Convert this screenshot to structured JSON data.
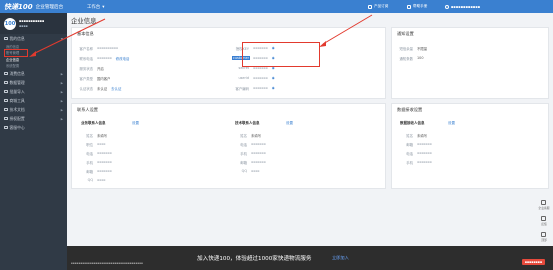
{
  "topbar": {
    "brand": "快递100",
    "subtitle": "企业管理后台",
    "console_label": "工作台",
    "caret": "▾",
    "right_links": [
      {
        "label": "产品订阅",
        "icon": "product-icon"
      },
      {
        "label": "帮助手册",
        "icon": "help-icon"
      }
    ],
    "user_label": "▪▪▪▪▪▪▪▪▪▪▪▪",
    "accent": "#3a80d0"
  },
  "sidebar": {
    "avatar_text": "100",
    "company": "▪▪▪▪▪▪▪▪▪▪▪",
    "status": "▪▪▪▪",
    "groups": [
      {
        "label": "我的信息",
        "icon": "user-card-icon",
        "expanded": true,
        "items": [
          {
            "label": "我的信息"
          },
          {
            "label": "账号管理"
          },
          {
            "label": "企业信息",
            "active": true
          },
          {
            "label": "系统配置"
          }
        ]
      },
      {
        "label": "消费信息",
        "icon": "wallet-icon"
      },
      {
        "label": "数据管理",
        "icon": "database-icon"
      },
      {
        "label": "批量导入",
        "icon": "import-icon"
      },
      {
        "label": "商城工具",
        "icon": "tool-icon"
      },
      {
        "label": "技术文档",
        "icon": "doc-icon"
      },
      {
        "label": "授权配置",
        "icon": "auth-icon"
      },
      {
        "label": "客服中心",
        "icon": "service-icon"
      }
    ]
  },
  "page": {
    "title": "企业信息"
  },
  "basic": {
    "title": "基本信息",
    "left_rows": [
      {
        "label": "客户名称",
        "value": "▪▪▪▪▪▪▪▪▪▪"
      },
      {
        "label": "联系电话",
        "value": "▪▪▪▪▪▪▪",
        "link": "修改电话"
      },
      {
        "label": "服务状态",
        "value": "开启"
      },
      {
        "label": "客户类型",
        "value": "国内客户"
      },
      {
        "label": "认证状态",
        "value": "未认证",
        "link": "去认证"
      }
    ],
    "right_rows": [
      {
        "label": "授权KEY",
        "value": "▪▪▪▪▪▪▪",
        "icon": "eye-icon"
      },
      {
        "label": "customer",
        "value": "▪▪▪▪▪▪▪",
        "icon": "eye-icon",
        "highlight": true
      },
      {
        "label": "secret",
        "value": "▪▪▪▪▪▪▪",
        "icon": "eye-icon"
      },
      {
        "label": "userid",
        "value": "▪▪▪▪▪▪▪",
        "icon": "eye-icon"
      },
      {
        "label": "客户编码",
        "value": "▪▪▪▪▪▪▪",
        "icon": "eye-icon"
      }
    ]
  },
  "notify": {
    "title": "通知设置",
    "rows": [
      {
        "label": "短信余量",
        "value": "不限量"
      },
      {
        "label": "通知条数",
        "value": "100"
      }
    ]
  },
  "contact": {
    "title": "联系人设置",
    "columns": [
      {
        "head": "业务联系人信息",
        "action": "设置",
        "rows": [
          {
            "label": "姓名",
            "value": "未填写"
          },
          {
            "label": "职位",
            "value": "▪▪▪▪"
          },
          {
            "label": "电话",
            "value": "▪▪▪▪▪▪▪"
          },
          {
            "label": "手机",
            "value": "▪▪▪▪▪▪▪"
          },
          {
            "label": "邮箱",
            "value": "▪▪▪▪▪▪▪"
          },
          {
            "label": "QQ",
            "value": "▪▪▪▪"
          }
        ]
      },
      {
        "head": "技术联系人信息",
        "action": "设置",
        "rows": [
          {
            "label": "姓名",
            "value": "未填写"
          },
          {
            "label": "电话",
            "value": "▪▪▪▪▪▪▪"
          },
          {
            "label": "手机",
            "value": "▪▪▪▪▪▪▪"
          },
          {
            "label": "邮箱",
            "value": "▪▪▪▪▪▪▪"
          },
          {
            "label": "QQ",
            "value": "▪▪▪▪"
          }
        ]
      }
    ]
  },
  "finance": {
    "title": "数据接收设置",
    "head": "数据接收人信息",
    "action": "设置",
    "rows": [
      {
        "label": "姓名",
        "value": "未填写"
      },
      {
        "label": "邮箱",
        "value": "▪▪▪▪▪▪▪"
      },
      {
        "label": "电话",
        "value": "▪▪▪▪▪▪▪"
      },
      {
        "label": "手机",
        "value": "▪▪▪▪▪▪▪"
      }
    ]
  },
  "float_bar": [
    {
      "label": "企业客服",
      "icon": "headset-icon"
    },
    {
      "label": "反馈",
      "icon": "feedback-icon"
    },
    {
      "label": "顶部",
      "icon": "top-icon"
    }
  ],
  "banner": {
    "text": "加入快递100，体验超过1000家快递物流服务",
    "link": "立即加入",
    "notice": "▪▪▪▪▪▪▪▪▪▪▪▪▪▪▪▪▪▪▪▪▪▪▪▪▪▪▪▪▪▪▪▪▪▪▪▪▪▪",
    "button": "▪▪▪▪▪▪▪▪"
  },
  "colors": {
    "sidebar_bg": "#303a46",
    "annotation_red": "#e23a2e",
    "banner_bg": "#2d2d2d"
  }
}
